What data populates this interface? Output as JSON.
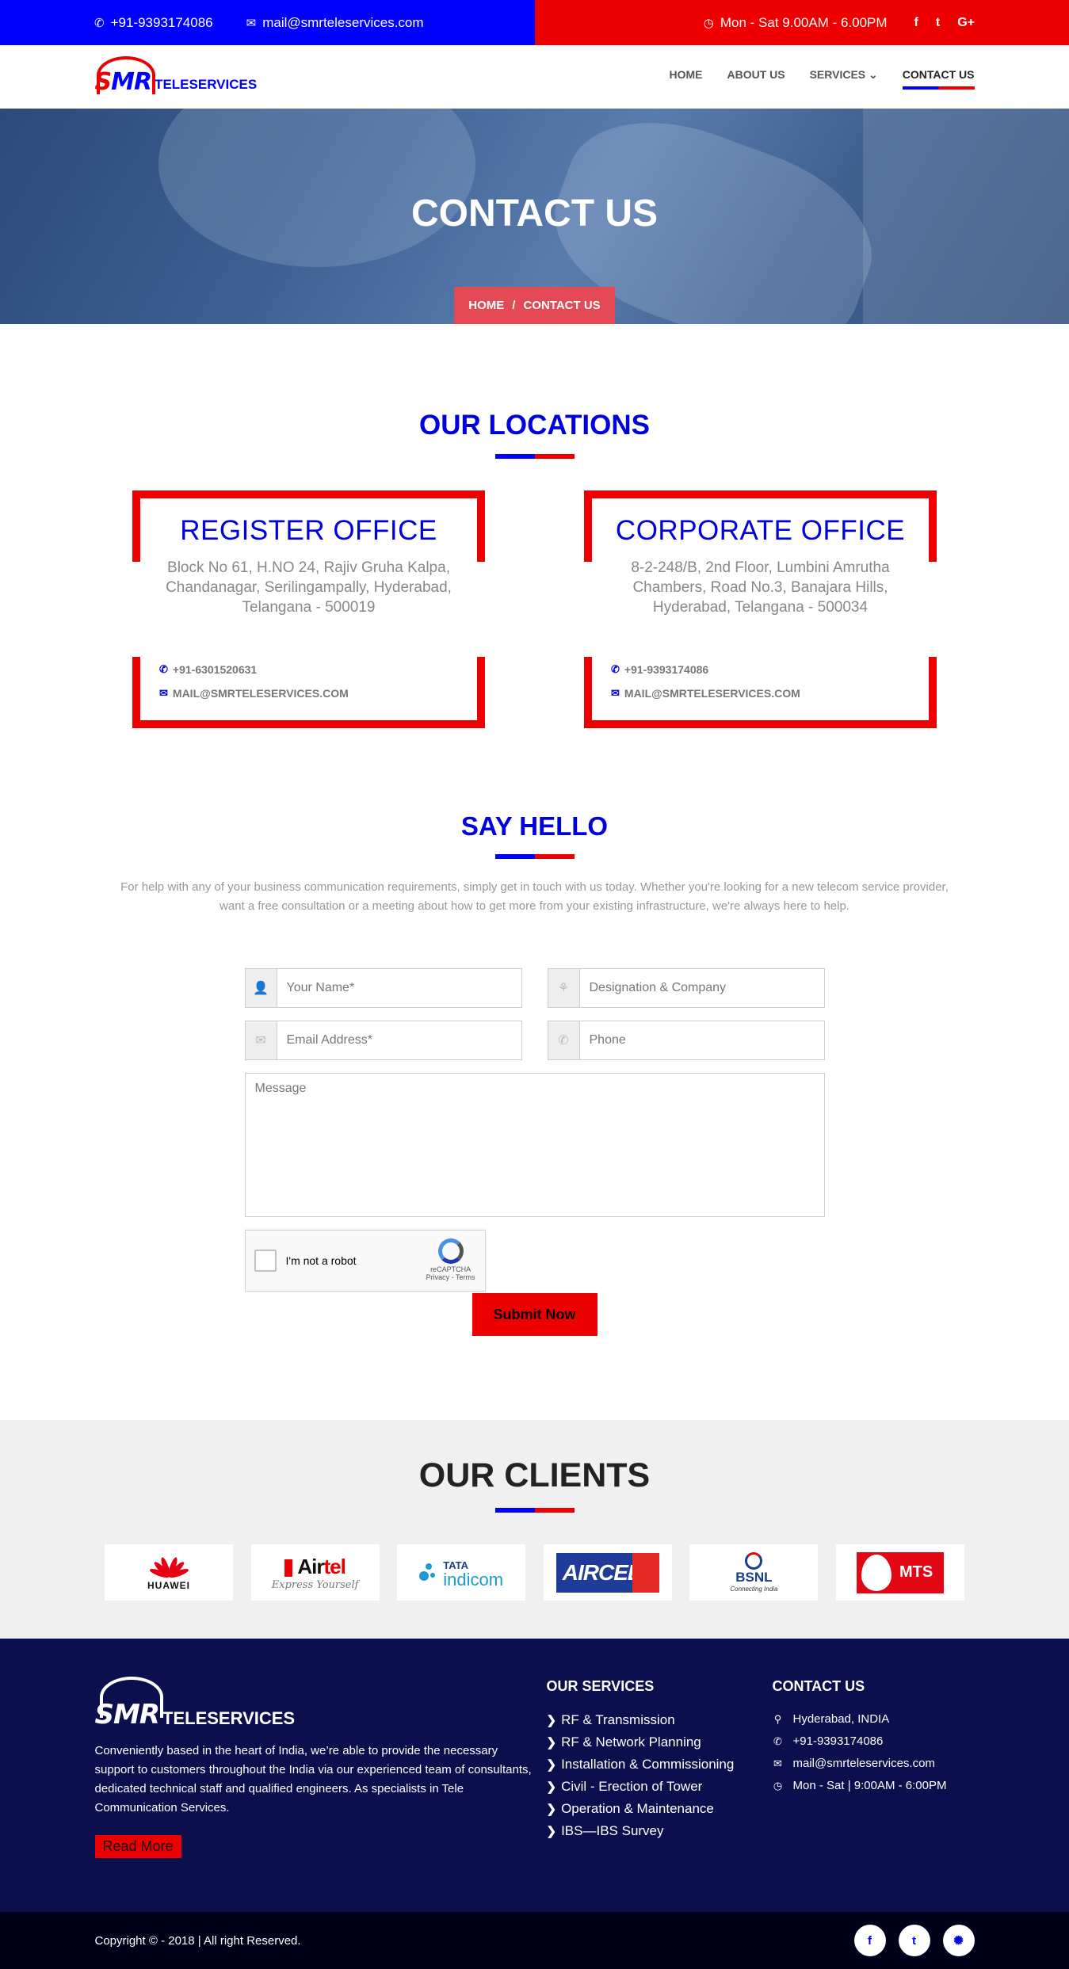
{
  "topbar": {
    "phone": "+91-9393174086",
    "email": "mail@smrteleservices.com",
    "hours": "Mon - Sat 9.00AM - 6.00PM",
    "social": [
      "f",
      "t",
      "G+"
    ]
  },
  "logo": {
    "smr_red": "S",
    "smr_blue": "MR",
    "tele": "TELESERVICES"
  },
  "nav": {
    "items": [
      {
        "label": "HOME"
      },
      {
        "label": "ABOUT US"
      },
      {
        "label": "SERVICES ⌄"
      },
      {
        "label": "CONTACT US",
        "active": true
      }
    ]
  },
  "hero": {
    "title": "CONTACT US",
    "crumb_home": "HOME",
    "crumb_sep": "/",
    "crumb_current": "CONTACT US"
  },
  "locations": {
    "title": "OUR LOCATIONS",
    "offices": [
      {
        "name": "REGISTER OFFICE",
        "address": "Block No 61, H.NO 24, Rajiv Gruha Kalpa, Chandanagar, Serilingampally, Hyderabad, Telangana - 500019",
        "phone": "+91-6301520631",
        "email": "MAIL@SMRTELESERVICES.COM"
      },
      {
        "name": "CORPORATE OFFICE",
        "address": "8-2-248/B, 2nd Floor, Lumbini Amrutha Chambers, Road No.3, Banajara Hills, Hyderabad, Telangana - 500034",
        "phone": "+91-9393174086",
        "email": "MAIL@SMRTELESERVICES.COM"
      }
    ]
  },
  "hello": {
    "title": "SAY HELLO",
    "text": "For help with any of your business communication requirements, simply get in touch with us today. Whether you're looking for a new telecom service provider, want a free consultation or a meeting about how to get more from your existing infrastructure, we're always here to help."
  },
  "form": {
    "name_placeholder": "Your Name*",
    "company_placeholder": "Designation & Company",
    "email_placeholder": "Email Address*",
    "phone_placeholder": "Phone",
    "message_placeholder": "Message",
    "captcha_label": "I'm not a robot",
    "captcha_brand": "reCAPTCHA",
    "captcha_links": "Privacy - Terms",
    "submit_label": "Submit Now"
  },
  "clients": {
    "title": "OUR CLIENTS",
    "huawei": "HUAWEI",
    "airtel_a": "Air",
    "airtel_b": "tel",
    "airtel_tag": "Express Yourself",
    "tata_a": "TATA",
    "tata_b": "indicom",
    "aircel": "AIRCEL",
    "bsnl": "BSNL",
    "bsnl_tag": "Connecting India",
    "mts": "MTS"
  },
  "footer": {
    "logo_smr": "SMR",
    "logo_tele": "TELESERVICES",
    "about": "Conveniently based in the heart of India, we’re able to provide the necessary support to customers throughout the India via our experienced team of consultants, dedicated technical staff and qualified engineers. As specialists in Tele Communication Services.",
    "read_more": "Read More",
    "services_title": "OUR SERVICES",
    "services": [
      "RF & Transmission",
      "RF & Network Planning",
      "Installation & Commissioning",
      "Civil - Erection of Tower",
      "Operation & Maintenance",
      "IBS—IBS Survey"
    ],
    "contact_title": "CONTACT US",
    "contact": {
      "location": "Hyderabad, INDIA",
      "phone": "+91-9393174086",
      "email": "mail@smrteleservices.com",
      "hours": "Mon - Sat | 9:00AM - 6:00PM"
    }
  },
  "bottom": {
    "copyright": "Copyright © - 2018 | All right Reserved.",
    "social": [
      "f",
      "t",
      "✺"
    ]
  },
  "colors": {
    "blue": "#0000ff",
    "red": "#ee0000",
    "footer": "#0b0f4e"
  }
}
